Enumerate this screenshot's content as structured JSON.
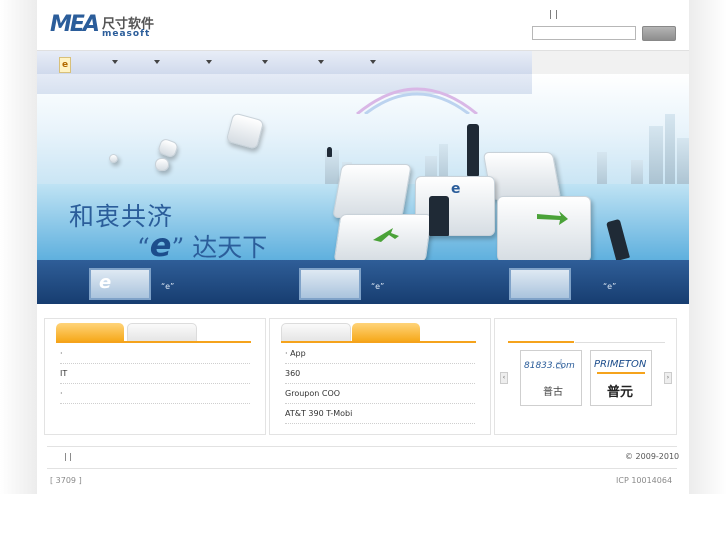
{
  "header": {
    "logo_mark": "MEA",
    "logo_cn": "尺寸软件",
    "logo_en": "measoft",
    "toplinks": "|   |",
    "search": {
      "value": "",
      "button_label": ""
    }
  },
  "nav": {
    "home_label": "e",
    "items": [
      "",
      "",
      "",
      "",
      "",
      ""
    ]
  },
  "banner": {
    "slogan_line1": "和衷共济",
    "slogan_line2_open": "“",
    "slogan_e": "e",
    "slogan_line2_close": "”",
    "slogan_line2_rest": "达天下"
  },
  "strip": {
    "items": [
      "“e”",
      "“e”",
      "“e”"
    ]
  },
  "box1": {
    "tabs": [
      "",
      ""
    ],
    "rows": [
      "·",
      "IT",
      "·"
    ]
  },
  "box2": {
    "tabs": [
      "",
      ""
    ],
    "rows": [
      "· App",
      "360",
      "Groupon   COO",
      "AT&T  390    T-Mobi"
    ]
  },
  "box3": {
    "partners": [
      {
        "name_top": "81833.com",
        "name_bottom": "普古"
      },
      {
        "name_top": "PRIMETON",
        "name_bottom": "普元"
      }
    ],
    "prev": "‹",
    "next": "›"
  },
  "footer": {
    "links": "|     |",
    "copyright": "© 2009-2010",
    "left_info": "[        3709   ]",
    "icp": "ICP 10014064"
  },
  "colors": {
    "accent": "#f6a91c",
    "navy": "#1f4a82",
    "brand_blue": "#2b5d9a"
  }
}
